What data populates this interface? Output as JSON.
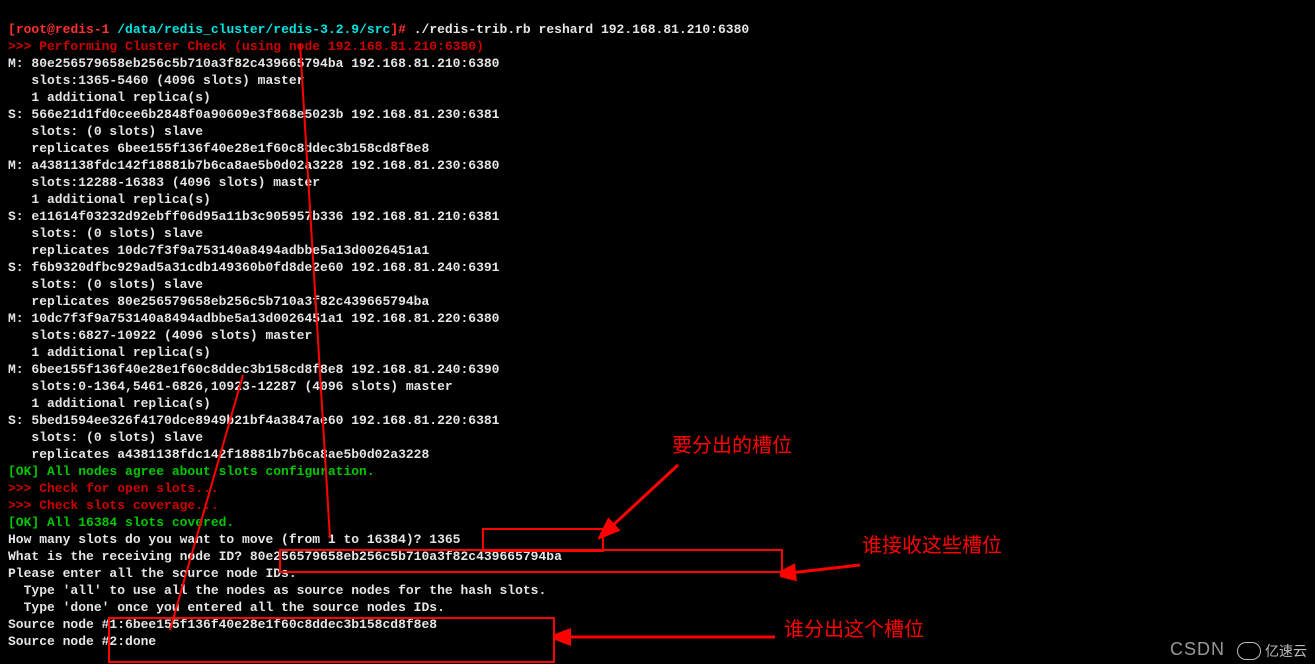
{
  "prompt": {
    "bracket_open": "[",
    "user": "root",
    "at": "@",
    "host": "redis-1",
    "path": " /data/redis_cluster/redis-3.2.9/src",
    "bracket_close": "]# ",
    "command": "./redis-trib.rb reshard 192.168.81.210:6380"
  },
  "lines": {
    "performing": ">>> Performing Cluster Check (using node 192.168.81.210:6380)",
    "m1a": "M: 80e256579658eb256c5b710a3f82c439665794ba 192.168.81.210:6380",
    "m1b": "   slots:1365-5460 (4096 slots) master",
    "m1c": "   1 additional replica(s)",
    "s1a": "S: 566e21d1fd0cee6b2848f0a90609e3f868e5023b 192.168.81.230:6381",
    "s1b": "   slots: (0 slots) slave",
    "s1c": "   replicates 6bee155f136f40e28e1f60c8ddec3b158cd8f8e8",
    "m2a": "M: a4381138fdc142f18881b7b6ca8ae5b0d02a3228 192.168.81.230:6380",
    "m2b": "   slots:12288-16383 (4096 slots) master",
    "m2c": "   1 additional replica(s)",
    "s2a": "S: e11614f03232d92ebff06d95a11b3c905957b336 192.168.81.210:6381",
    "s2b": "   slots: (0 slots) slave",
    "s2c": "   replicates 10dc7f3f9a753140a8494adbbe5a13d0026451a1",
    "s3a": "S: f6b9320dfbc929ad5a31cdb149360b0fd8de2e60 192.168.81.240:6391",
    "s3b": "   slots: (0 slots) slave",
    "s3c": "   replicates 80e256579658eb256c5b710a3f82c439665794ba",
    "m3a": "M: 10dc7f3f9a753140a8494adbbe5a13d0026451a1 192.168.81.220:6380",
    "m3b": "   slots:6827-10922 (4096 slots) master",
    "m3c": "   1 additional replica(s)",
    "m4a": "M: 6bee155f136f40e28e1f60c8ddec3b158cd8f8e8 192.168.81.240:6390",
    "m4b": "   slots:0-1364,5461-6826,10923-12287 (4096 slots) master",
    "m4c": "   1 additional replica(s)",
    "s4a": "S: 5bed1594ee326f4170dce8949b21bf4a3847ae60 192.168.81.220:6381",
    "s4b": "   slots: (0 slots) slave",
    "s4c": "   replicates a4381138fdc142f18881b7b6ca8ae5b0d02a3228",
    "ok1": "[OK] All nodes agree about slots configuration.",
    "check1": ">>> Check for open slots...",
    "check2": ">>> Check slots coverage...",
    "ok2": "[OK] All 16384 slots covered.",
    "q1": "How many slots do you want to move (from 1 to 16384)? 1365",
    "q2": "What is the receiving node ID? 80e256579658eb256c5b710a3f82c439665794ba",
    "q3": "Please enter all the source node IDs.",
    "q4": "  Type 'all' to use all the nodes as source nodes for the hash slots.",
    "q5": "  Type 'done' once you entered all the source nodes IDs.",
    "sn1": "Source node #1:6bee155f136f40e28e1f60c8ddec3b158cd8f8e8",
    "sn2": "Source node #2:done"
  },
  "annotations": {
    "a1": "要分出的槽位",
    "a2": "谁接收这些槽位",
    "a3": "谁分出这个槽位"
  },
  "watermark": {
    "csdn": "CSDN",
    "logo": "亿速云"
  }
}
